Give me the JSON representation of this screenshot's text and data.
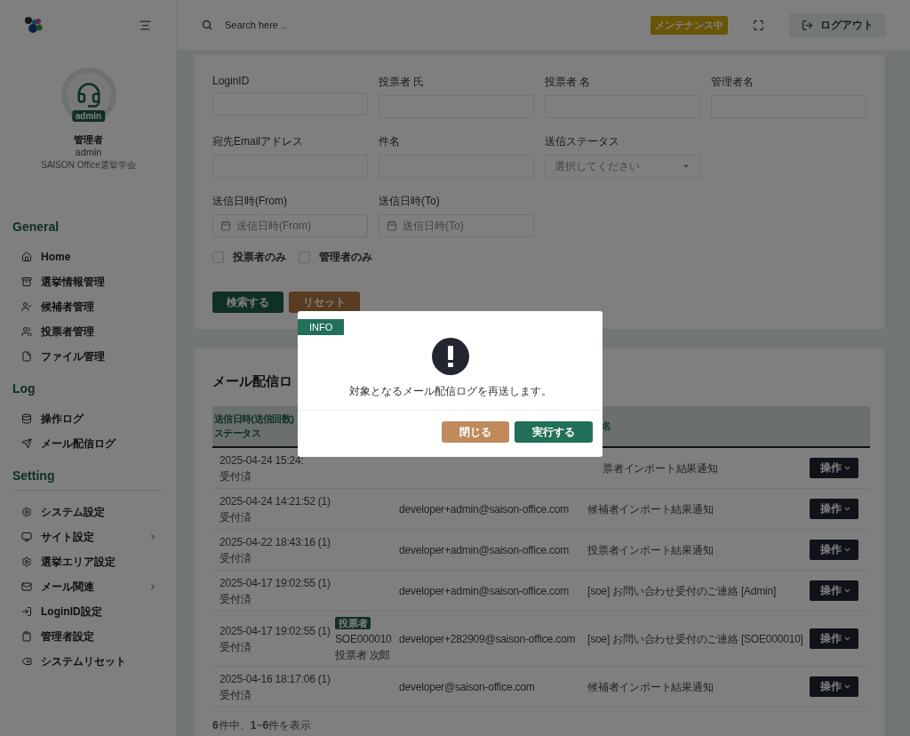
{
  "sidebar": {
    "profile": {
      "badge": "admin",
      "role": "管理者",
      "user": "admin",
      "org": "SAISON Office選挙学会"
    },
    "sections": [
      {
        "title": "General",
        "divider": false,
        "items": [
          {
            "label": "Home",
            "has_submenu": false
          },
          {
            "label": "選挙情報管理",
            "has_submenu": false
          },
          {
            "label": "候補者管理",
            "has_submenu": false
          },
          {
            "label": "投票者管理",
            "has_submenu": false
          },
          {
            "label": "ファイル管理",
            "has_submenu": false
          }
        ]
      },
      {
        "title": "Log",
        "divider": false,
        "items": [
          {
            "label": "操作ログ",
            "has_submenu": false
          },
          {
            "label": "メール配信ログ",
            "has_submenu": false
          }
        ]
      },
      {
        "title": "Setting",
        "divider": true,
        "items": [
          {
            "label": "システム設定",
            "has_submenu": false
          },
          {
            "label": "サイト設定",
            "has_submenu": true
          },
          {
            "label": "選挙エリア設定",
            "has_submenu": false
          },
          {
            "label": "メール関連",
            "has_submenu": true
          },
          {
            "label": "LoginID設定",
            "has_submenu": false
          },
          {
            "label": "管理者設定",
            "has_submenu": false
          },
          {
            "label": "システムリセット",
            "has_submenu": false
          }
        ]
      }
    ]
  },
  "topbar": {
    "search": {
      "placeholder": "Search here .."
    },
    "badge": "メンテナンス中",
    "logout": "ログアウト"
  },
  "filters": [
    [
      {
        "kind": "text",
        "label": "LoginID"
      },
      {
        "kind": "text",
        "label": "投票者 氏"
      },
      {
        "kind": "text",
        "label": "投票者 名"
      },
      {
        "kind": "text",
        "label": "管理者名"
      }
    ],
    [
      {
        "kind": "text",
        "label": "宛先Emailアドレス"
      },
      {
        "kind": "text",
        "label": "件名"
      },
      {
        "kind": "select",
        "label": "送信ステータス",
        "placeholder": "選択してください"
      }
    ],
    [
      {
        "kind": "date",
        "label": "送信日時(From)",
        "placeholder": "送信日時(From)"
      },
      {
        "kind": "date",
        "label": "送信日時(To)",
        "placeholder": "送信日時(To)"
      }
    ]
  ],
  "checkboxes": [
    {
      "label": "投票者のみ",
      "checked": false
    },
    {
      "label": "管理者のみ",
      "checked": false
    }
  ],
  "filter_buttons": {
    "search": "検索する",
    "reset": "リセット"
  },
  "log": {
    "title": "メール配信ロ",
    "header": {
      "column_1": [
        "送信日時(送信回数)",
        "ステータス"
      ],
      "column_4": "名"
    },
    "rows": [
      {
        "date": "2025-04-24 15:24:",
        "status": "受付済",
        "subject": "票者インポート結果通知",
        "action": "操作"
      },
      {
        "date": "2025-04-24 14:21:52 (1)",
        "status": "受付済",
        "email": "developer+admin@saison-office.com",
        "subject": "候補者インポート結果通知",
        "action": "操作"
      },
      {
        "date": "2025-04-22 18:43:16 (1)",
        "status": "受付済",
        "email": "developer+admin@saison-office.com",
        "subject": "投票者インポート結果通知",
        "action": "操作"
      },
      {
        "date": "2025-04-17 19:02:55 (1)",
        "status": "受付済",
        "email": "developer+admin@saison-office.com",
        "subject": "[soe] お問い合わせ受付のご連絡 [Admin]",
        "action": "操作"
      },
      {
        "date": "2025-04-17 19:02:55 (1)",
        "status": "受付済",
        "voter": {
          "badge": "投票者",
          "id": "SOE000010",
          "name": "投票者 次郎"
        },
        "email": "developer+282909@saison-office.com",
        "subject": "[soe] お問い合わせ受付のご連絡 [SOE000010]",
        "action": "操作"
      },
      {
        "date": "2025-04-16 18:17:06 (1)",
        "status": "受付済",
        "email": "developer@saison-office.com",
        "subject": "候補者インポート結果通知",
        "action": "操作"
      }
    ],
    "footer": "**6**件中、**1**~**6**件を表示"
  },
  "modal": {
    "tag": "INFO",
    "message": "対象となるメール配信ログを再送します。",
    "close": "閉じる",
    "confirm": "実行する"
  }
}
